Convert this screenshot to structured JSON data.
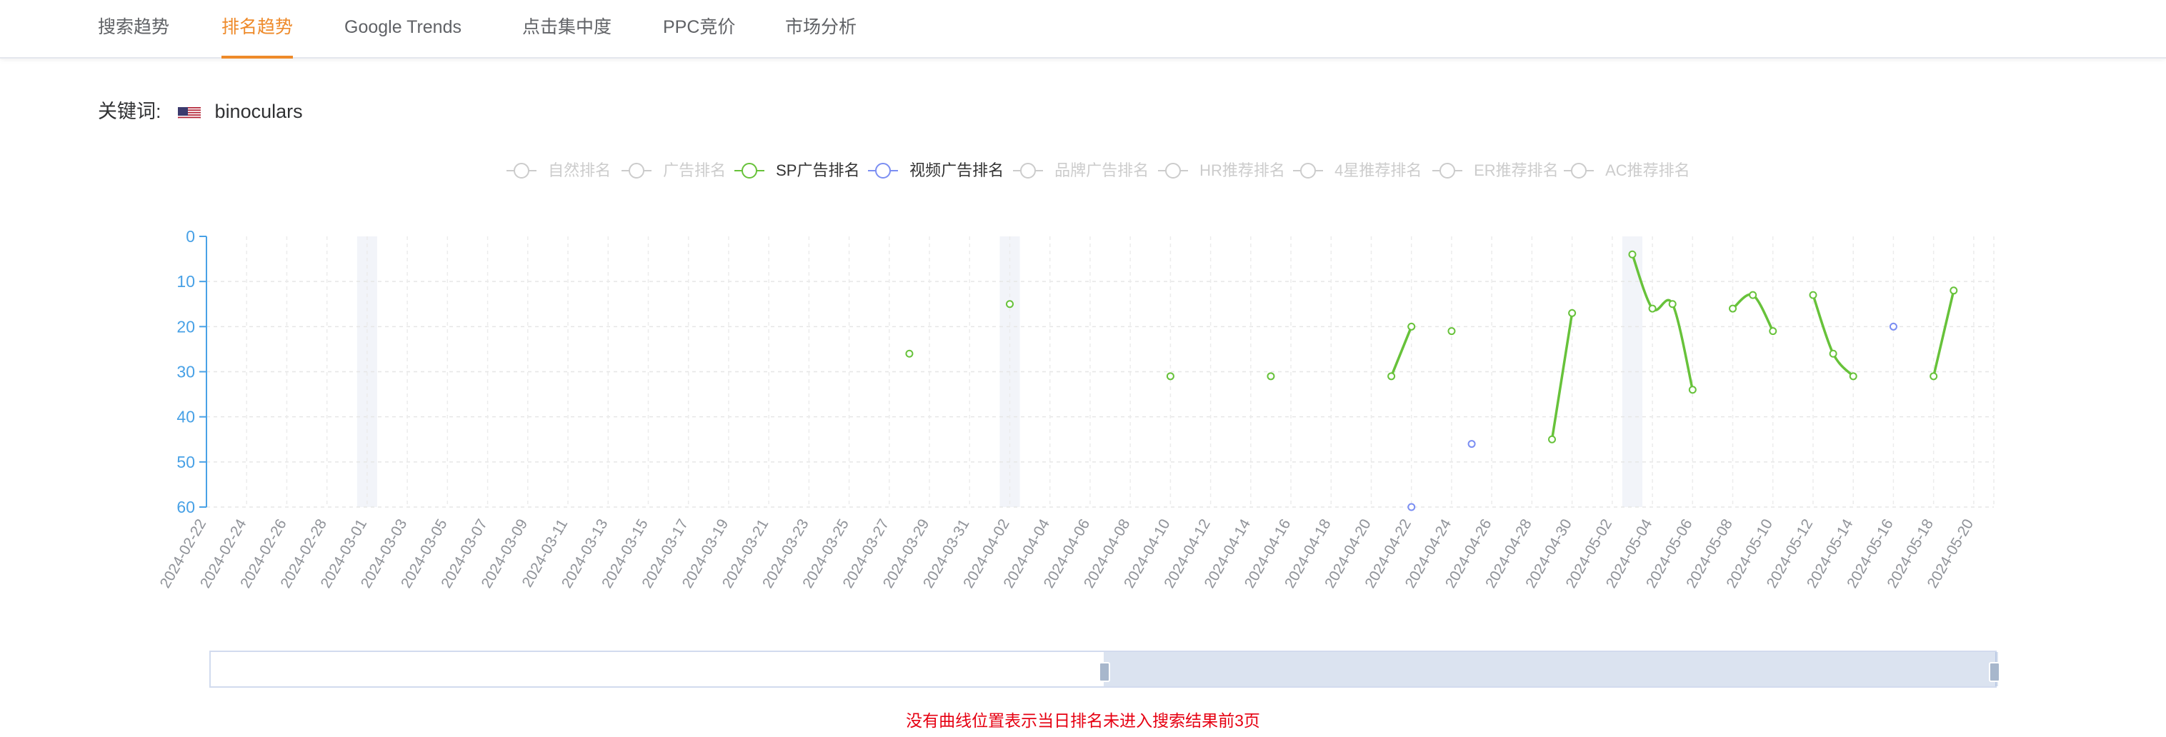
{
  "tabs": [
    {
      "label": "搜索趋势",
      "active": false
    },
    {
      "label": "排名趋势",
      "active": true
    },
    {
      "label": "Google Trends",
      "active": false
    },
    {
      "label": "点击集中度",
      "active": false
    },
    {
      "label": "PPC竞价",
      "active": false
    },
    {
      "label": "市场分析",
      "active": false
    }
  ],
  "keyword": {
    "label": "关键词:",
    "flag_icon": "us-flag-icon",
    "value": "binoculars"
  },
  "legend": [
    {
      "label": "自然排名",
      "active": false,
      "color": "#cccccc"
    },
    {
      "label": "广告排名",
      "active": false,
      "color": "#cccccc"
    },
    {
      "label": "SP广告排名",
      "active": true,
      "color": "#67c23a"
    },
    {
      "label": "视频广告排名",
      "active": true,
      "color": "#7b8ef2"
    },
    {
      "label": "品牌广告排名",
      "active": false,
      "color": "#cccccc"
    },
    {
      "label": "HR推荐排名",
      "active": false,
      "color": "#cccccc"
    },
    {
      "label": "4星推荐排名",
      "active": false,
      "color": "#cccccc"
    },
    {
      "label": "ER推荐排名",
      "active": false,
      "color": "#cccccc"
    },
    {
      "label": "AC推荐排名",
      "active": false,
      "color": "#cccccc"
    }
  ],
  "chart_data": {
    "type": "line",
    "y_inverted": true,
    "ylim": [
      0,
      60
    ],
    "yticks": [
      0,
      10,
      20,
      30,
      40,
      50,
      60
    ],
    "grid": true,
    "legend_position": "top-center",
    "x_start": "2024-02-22",
    "x_end": "2024-05-21",
    "x_tick_labels": [
      "2024-02-22",
      "2024-02-24",
      "2024-02-26",
      "2024-02-28",
      "2024-03-01",
      "2024-03-03",
      "2024-03-05",
      "2024-03-07",
      "2024-03-09",
      "2024-03-11",
      "2024-03-13",
      "2024-03-15",
      "2024-03-17",
      "2024-03-19",
      "2024-03-21",
      "2024-03-23",
      "2024-03-25",
      "2024-03-27",
      "2024-03-29",
      "2024-03-31",
      "2024-04-02",
      "2024-04-04",
      "2024-04-06",
      "2024-04-08",
      "2024-04-10",
      "2024-04-12",
      "2024-04-14",
      "2024-04-16",
      "2024-04-18",
      "2024-04-20",
      "2024-04-22",
      "2024-04-24",
      "2024-04-26",
      "2024-04-28",
      "2024-04-30",
      "2024-05-02",
      "2024-05-04",
      "2024-05-06",
      "2024-05-08",
      "2024-05-10",
      "2024-05-12",
      "2024-05-14",
      "2024-05-16",
      "2024-05-18",
      "2024-05-20"
    ],
    "highlight_dates": [
      "2024-03-01",
      "2024-04-02",
      "2024-05-03"
    ],
    "series": [
      {
        "name": "SP广告排名",
        "color": "#67c23a",
        "points": [
          [
            "2024-03-28",
            26
          ],
          [
            "2024-04-02",
            15
          ],
          [
            "2024-04-10",
            31
          ],
          [
            "2024-04-15",
            31
          ],
          [
            "2024-04-21",
            31
          ],
          [
            "2024-04-22",
            20
          ],
          [
            "2024-04-24",
            21
          ],
          [
            "2024-04-29",
            45
          ],
          [
            "2024-04-30",
            17
          ],
          [
            "2024-05-03",
            4
          ],
          [
            "2024-05-04",
            16
          ],
          [
            "2024-05-05",
            15
          ],
          [
            "2024-05-06",
            34
          ],
          [
            "2024-05-08",
            16
          ],
          [
            "2024-05-09",
            13
          ],
          [
            "2024-05-10",
            21
          ],
          [
            "2024-05-12",
            13
          ],
          [
            "2024-05-13",
            26
          ],
          [
            "2024-05-14",
            31
          ],
          [
            "2024-05-18",
            31
          ],
          [
            "2024-05-19",
            12
          ]
        ]
      },
      {
        "name": "视频广告排名",
        "color": "#7b8ef2",
        "points": [
          [
            "2024-04-22",
            60
          ],
          [
            "2024-04-25",
            46
          ],
          [
            "2024-05-16",
            20
          ]
        ]
      }
    ]
  },
  "zoom": {
    "start_fraction": 0.5,
    "end_fraction": 1.0
  },
  "note": "没有曲线位置表示当日排名未进入搜索结果前3页"
}
